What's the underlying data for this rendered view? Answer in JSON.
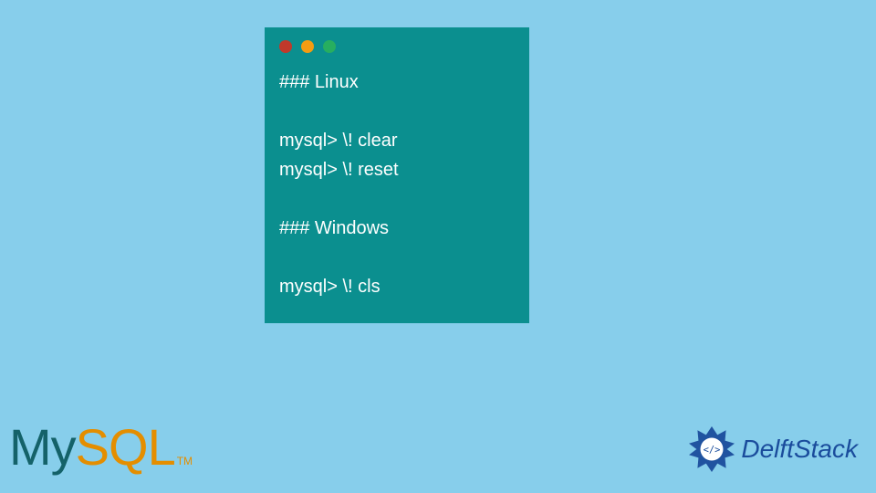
{
  "code_window": {
    "lines": "### Linux\n\nmysql> \\! clear\nmysql> \\! reset\n\n### Windows\n\nmysql> \\! cls"
  },
  "mysql_logo": {
    "part1": "My",
    "part2": "SQL",
    "tm": "TM"
  },
  "delftstack": {
    "text": "DelftStack"
  },
  "colors": {
    "background": "#87ceeb",
    "code_bg": "#0b8f8f",
    "mysql_my": "#146269",
    "mysql_sql": "#e48e00",
    "delft_blue": "#1a4c9c"
  }
}
